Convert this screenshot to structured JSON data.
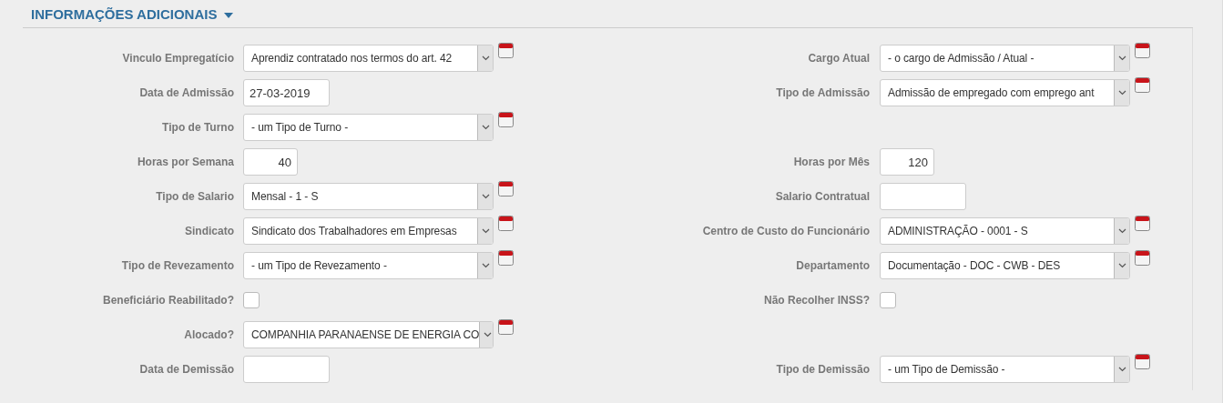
{
  "section": {
    "title": "INFORMAÇÕES ADICIONAIS",
    "expanded": true
  },
  "rows": [
    {
      "left": {
        "label": "Vinculo Empregatício",
        "kind": "select",
        "value": "Aprendiz contratado nos termos do art. 42"
      },
      "right": {
        "label": "Cargo Atual",
        "kind": "select",
        "value": "- o cargo de Admissão / Atual -"
      }
    },
    {
      "left": {
        "label": "Data de Admissão",
        "kind": "date",
        "value": "27-03-2019"
      },
      "right": {
        "label": "Tipo de Admissão",
        "kind": "select",
        "value": "Admissão de empregado com emprego ant"
      }
    },
    {
      "left": {
        "label": "Tipo de Turno",
        "kind": "select",
        "value": "- um Tipo de Turno -"
      }
    },
    {
      "left": {
        "label": "Horas por Semana",
        "kind": "number",
        "value": "40"
      },
      "right": {
        "label": "Horas por Mês",
        "kind": "number",
        "value": "120"
      }
    },
    {
      "left": {
        "label": "Tipo de Salario",
        "kind": "select",
        "value": "Mensal - 1 - S"
      },
      "right": {
        "label": "Salario Contratual",
        "kind": "date"
      }
    },
    {
      "left": {
        "label": "Sindicato",
        "kind": "select",
        "value": "Sindicato dos Trabalhadores em Empresas"
      },
      "right": {
        "label": "Centro de Custo do Funcionário",
        "kind": "select",
        "value": "ADMINISTRAÇÃO - 0001 - S"
      }
    },
    {
      "left": {
        "label": "Tipo de Revezamento",
        "kind": "select",
        "value": "- um Tipo de Revezamento -"
      },
      "right": {
        "label": "Departamento",
        "kind": "select",
        "value": "Documentação - DOC - CWB - DES"
      }
    },
    {
      "left": {
        "label": "Beneficiário Reabilitado?",
        "kind": "checkbox",
        "checked": false
      },
      "right": {
        "label": "Não Recolher INSS?",
        "kind": "checkbox",
        "checked": false
      }
    },
    {
      "left": {
        "label": "Alocado?",
        "kind": "select",
        "value": "COMPANHIA PARANAENSE DE ENERGIA CO"
      }
    },
    {
      "left": {
        "label": "Data de Demissão",
        "kind": "date"
      },
      "right": {
        "label": "Tipo de Demissão",
        "kind": "select",
        "value": "- um Tipo de Demissão -"
      }
    }
  ]
}
